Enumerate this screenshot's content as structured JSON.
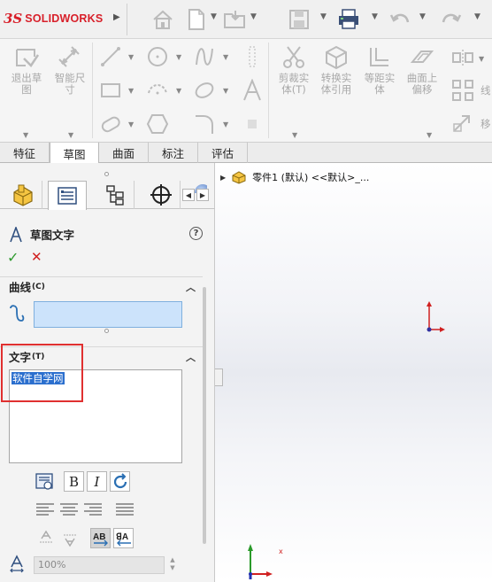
{
  "app": {
    "logo_prefix": "3S",
    "logo_text": "SOLIDWORKS"
  },
  "toolbar": {
    "icons": [
      "home-icon",
      "new-document-icon",
      "open-folder-icon",
      "save-icon",
      "print-icon",
      "undo-icon",
      "redo-icon"
    ]
  },
  "ribbon": {
    "exit_sketch": "退出草\n图",
    "smart_dimension": "智能尺\n寸",
    "trim": "剪裁实\n体(T)",
    "convert": "转换实\n体引用",
    "offset": "等距实\n体",
    "offset_surface": "曲面上\n偏移",
    "line_partial": "线",
    "move_partial": "移"
  },
  "tabs": [
    {
      "label": "特征"
    },
    {
      "label": "草图"
    },
    {
      "label": "曲面"
    },
    {
      "label": "标注"
    },
    {
      "label": "评估"
    }
  ],
  "panel": {
    "title": "草图文字",
    "help": "?",
    "ok": "✓",
    "cancel": "✕",
    "curve_group": "曲线",
    "curve_hotkey": "(C)",
    "text_group": "文字",
    "text_hotkey": "(T)",
    "text_value": "软件自学网",
    "width_factor": "100%"
  },
  "tree": {
    "part": "零件1 (默认) <<默认>_..."
  },
  "colors": {
    "brand": "#d8202a",
    "selection": "#2b6fce",
    "highlight_box": "#e03030",
    "curve_field": "#cce3fb"
  }
}
